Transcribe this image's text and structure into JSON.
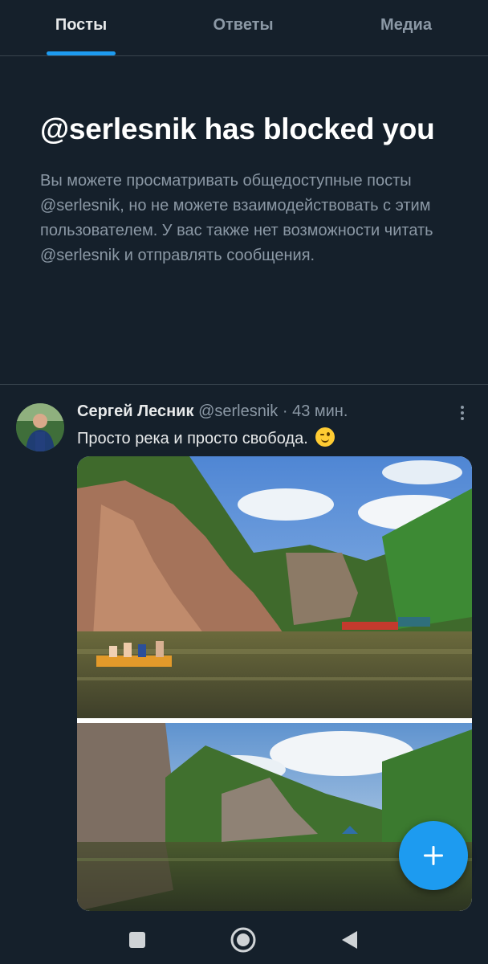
{
  "tabs": [
    {
      "label": "Посты",
      "active": true
    },
    {
      "label": "Ответы",
      "active": false
    },
    {
      "label": "Медиа",
      "active": false
    }
  ],
  "blocked": {
    "title": "@serlesnik has blocked you",
    "description": "Вы можете просматривать общедоступные посты @serlesnik, но не можете взаимодействовать с этим пользователем. У вас также нет возможности читать @serlesnik и отправлять сообщения."
  },
  "post": {
    "author": "Сергей Лесник",
    "handle": "@serlesnik",
    "separator": "·",
    "time": "43 мин.",
    "text": "Просто река и просто свобода.",
    "emoji": "winking-face"
  },
  "colors": {
    "background": "#15202b",
    "accent": "#1d9bf0",
    "secondary_text": "#8b98a5",
    "divider": "#38444d"
  },
  "icons": {
    "more": "more-vertical-icon",
    "fab": "plus-icon",
    "nav": [
      "square-icon",
      "circle-icon",
      "back-triangle-icon"
    ]
  }
}
